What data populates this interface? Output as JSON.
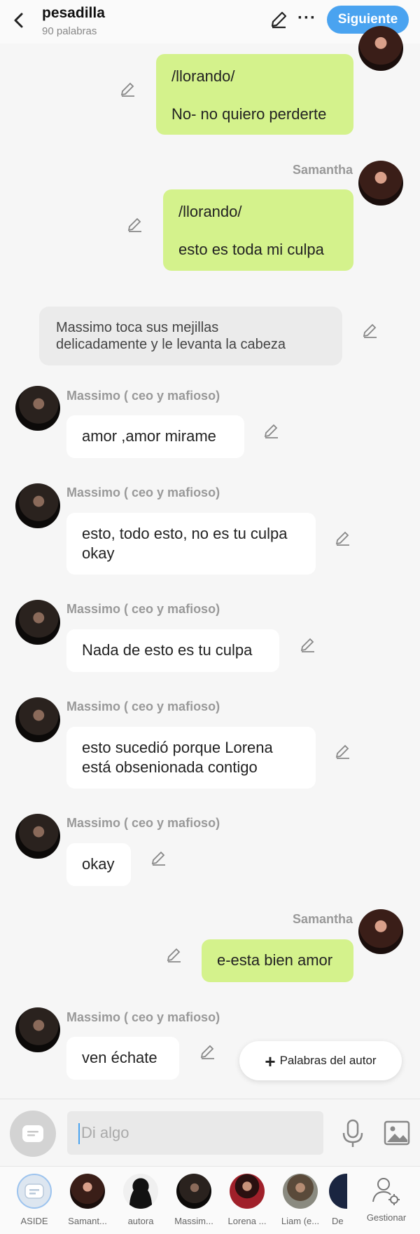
{
  "header": {
    "title": "pesadilla",
    "subtitle": "90 palabras",
    "next_label": "Siguiente"
  },
  "messages": [
    {
      "line1": "/llorando/",
      "line2": "No- no quiero perderte"
    },
    {
      "name": "Samantha",
      "line1": "/llorando/",
      "line2": "esto es toda mi culpa"
    },
    {
      "narration_l1": "Massimo toca sus mejillas",
      "narration_l2": "delicadamente y le levanta la cabeza"
    },
    {
      "name": "Massimo ( ceo y mafioso)",
      "text": "amor ,amor mirame"
    },
    {
      "name": "Massimo ( ceo y mafioso)",
      "line1": "esto, todo esto, no es tu culpa",
      "line2": "okay"
    },
    {
      "name": "Massimo ( ceo y mafioso)",
      "text": "Nada de esto es tu culpa"
    },
    {
      "name": "Massimo ( ceo y mafioso)",
      "line1": "esto sucedió porque Lorena",
      "line2": "está obsenionada contigo"
    },
    {
      "name": "Massimo ( ceo y mafioso)",
      "text": "okay"
    },
    {
      "name": "Samantha",
      "text": "e-esta bien amor"
    },
    {
      "name": "Massimo ( ceo y mafioso)",
      "text": "ven échate"
    }
  ],
  "fab_label": "Palabras del autor",
  "input": {
    "placeholder": "Di algo"
  },
  "characters": [
    {
      "label": "ASIDE"
    },
    {
      "label": "Samant..."
    },
    {
      "label": "autora"
    },
    {
      "label": "Massim..."
    },
    {
      "label": "Lorena ..."
    },
    {
      "label": "Liam (e..."
    },
    {
      "label": "De"
    },
    {
      "label": "Gestionar"
    }
  ],
  "colors": {
    "accent": "#4aa3f0",
    "my_bubble": "#d4f28c",
    "their_bubble": "#ffffff",
    "narration": "#ebebeb"
  }
}
